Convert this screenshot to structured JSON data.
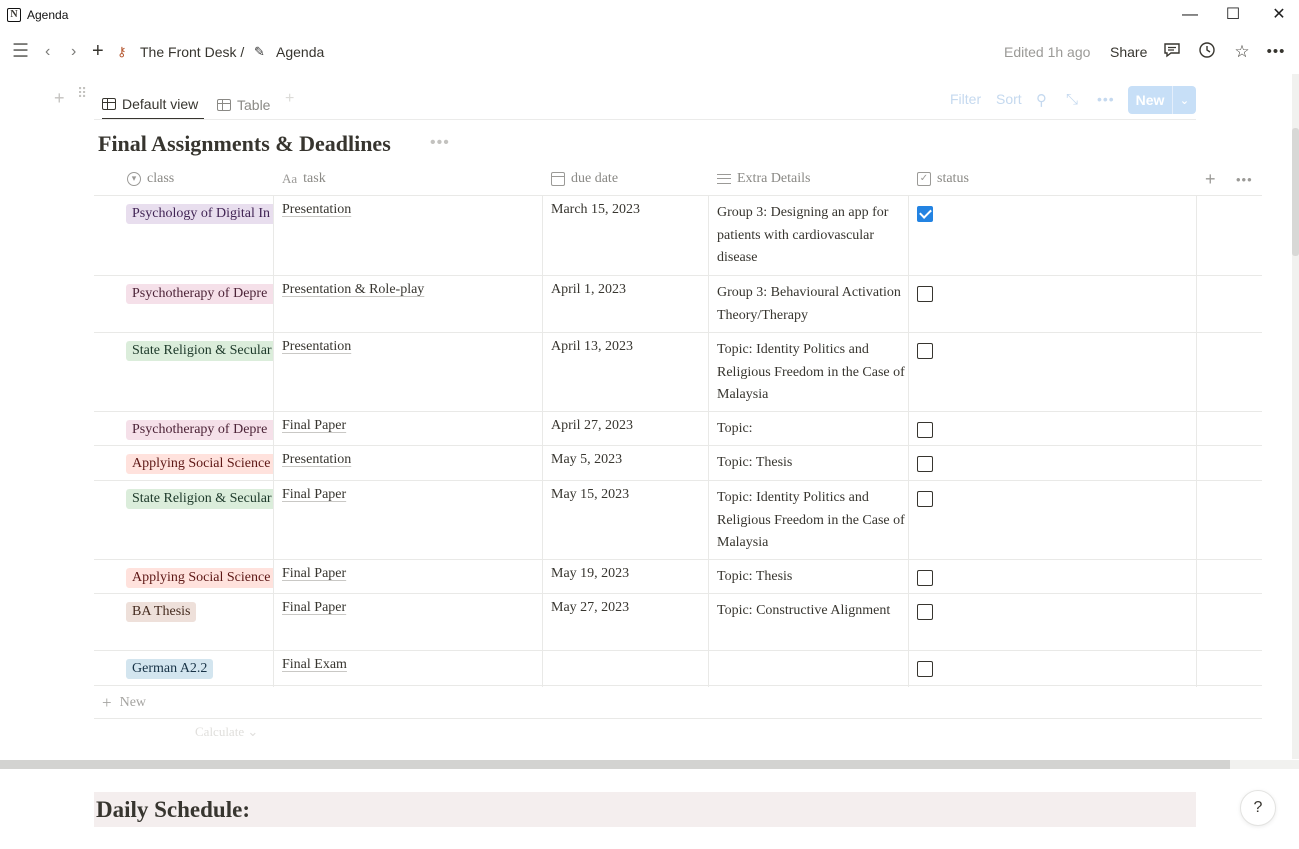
{
  "window": {
    "title": "Agenda",
    "controls": {
      "minimize": "—",
      "maximize": "☐",
      "close": "✕"
    }
  },
  "topbar": {
    "breadcrumbs": [
      {
        "label": "The Front Desk /",
        "icon": "key-icon"
      },
      {
        "label": "Agenda",
        "icon": "pen-icon"
      }
    ],
    "edited": "Edited 1h ago",
    "share": "Share"
  },
  "views": {
    "tabs": [
      {
        "label": "Default view",
        "active": true
      },
      {
        "label": "Table",
        "active": false
      }
    ],
    "toolbar": {
      "filter": "Filter",
      "sort": "Sort",
      "new": "New"
    }
  },
  "database": {
    "title": "Final Assignments & Deadlines",
    "columns": {
      "class": "class",
      "task": "task",
      "due": "due date",
      "details": "Extra Details",
      "status": "status"
    },
    "rows": [
      {
        "class": "Psychology of Digital In",
        "tag_color": "#e8deee",
        "tag_text": "#412454",
        "task": "Presentation",
        "due": "March 15, 2023",
        "details": "Group 3: Designing an app for patients with cardiovascular disease",
        "done": true
      },
      {
        "class": "Psychotherapy of Depre",
        "tag_color": "#f5e0e9",
        "tag_text": "#4c2337",
        "task": "Presentation & Role-play",
        "due": "April 1, 2023",
        "details": "Group 3: Behavioural Activation Theory/Therapy",
        "done": false
      },
      {
        "class": "State Religion & Secular",
        "tag_color": "#dbeddb",
        "tag_text": "#1c3829",
        "task": "Presentation",
        "due": "April 13, 2023",
        "details": "Topic: Identity Politics and Religious Freedom in the Case of Malaysia",
        "done": false
      },
      {
        "class": "Psychotherapy of Depre",
        "tag_color": "#f5e0e9",
        "tag_text": "#4c2337",
        "task": "Final Paper",
        "due": "April 27, 2023",
        "details": "Topic:",
        "done": false
      },
      {
        "class": "Applying Social Science",
        "tag_color": "#ffe2dd",
        "tag_text": "#5d1715",
        "task": "Presentation",
        "due": "May 5, 2023",
        "details": "Topic: Thesis",
        "done": false
      },
      {
        "class": "State Religion & Secular",
        "tag_color": "#dbeddb",
        "tag_text": "#1c3829",
        "task": "Final Paper",
        "due": "May 15, 2023",
        "details": "Topic: Identity Politics and Religious Freedom in the Case of Malaysia",
        "done": false
      },
      {
        "class": "Applying Social Science",
        "tag_color": "#ffe2dd",
        "tag_text": "#5d1715",
        "task": "Final Paper",
        "due": "May 19, 2023",
        "details": "Topic: Thesis",
        "done": false
      },
      {
        "class": "BA Thesis",
        "tag_color": "#eee0da",
        "tag_text": "#442a1e",
        "task": "Final Paper",
        "due": "May 27, 2023",
        "details": "Topic: Constructive Alignment",
        "done": false
      },
      {
        "class": "German A2.2",
        "tag_color": "#d3e5ef",
        "tag_text": "#183347",
        "task": "Final Exam",
        "due": "",
        "details": "",
        "done": false
      }
    ],
    "new_row": "New",
    "calculate": "Calculate"
  },
  "next_section": {
    "title": "Daily Schedule:"
  },
  "help": "?"
}
